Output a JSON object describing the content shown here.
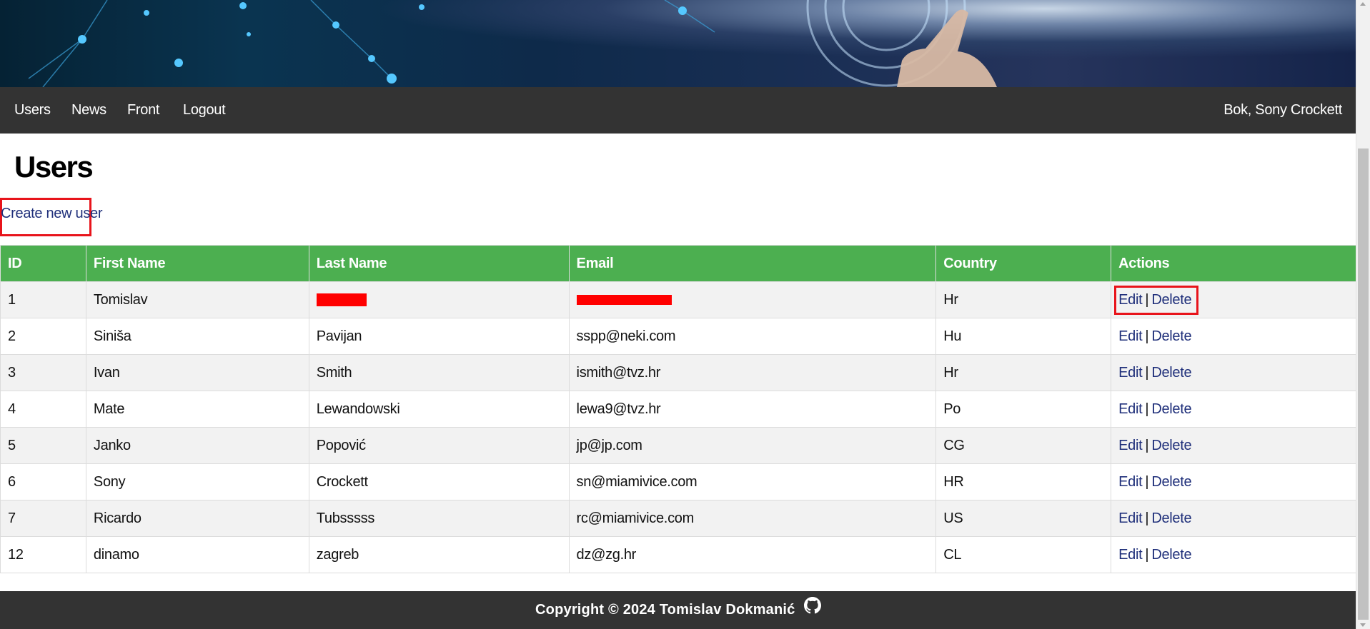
{
  "nav": {
    "links": [
      "Users",
      "News",
      "Front",
      "Logout"
    ],
    "greeting": "Bok, Sony Crockett"
  },
  "page": {
    "title": "Users",
    "create_link": "Create new user"
  },
  "table": {
    "headers": [
      "ID",
      "First Name",
      "Last Name",
      "Email",
      "Country",
      "Actions"
    ],
    "rows": [
      {
        "id": "1",
        "first": "Tomislav",
        "last": "",
        "email": "",
        "country": "Hr",
        "redacted": true
      },
      {
        "id": "2",
        "first": "Siniša",
        "last": "Pavijan",
        "email": "sspp@neki.com",
        "country": "Hu"
      },
      {
        "id": "3",
        "first": "Ivan",
        "last": "Smith",
        "email": "ismith@tvz.hr",
        "country": "Hr"
      },
      {
        "id": "4",
        "first": "Mate",
        "last": "Lewandowski",
        "email": "lewa9@tvz.hr",
        "country": "Po"
      },
      {
        "id": "5",
        "first": "Janko",
        "last": "Popović",
        "email": "jp@jp.com",
        "country": "CG"
      },
      {
        "id": "6",
        "first": "Sony",
        "last": "Crockett",
        "email": "sn@miamivice.com",
        "country": "HR"
      },
      {
        "id": "7",
        "first": "Ricardo",
        "last": "Tubsssss",
        "email": "rc@miamivice.com",
        "country": "US"
      },
      {
        "id": "12",
        "first": "dinamo",
        "last": "zagreb",
        "email": "dz@zg.hr",
        "country": "CL"
      }
    ],
    "edit_label": "Edit",
    "delete_label": "Delete",
    "separator": "|"
  },
  "footer": {
    "text": "Copyright © 2024 Tomislav Dokmanić",
    "icon": "github-icon"
  },
  "colors": {
    "header_green": "#4caf50",
    "nav_bg": "#333333",
    "link": "#1f2f7a",
    "highlight": "#e8141b"
  }
}
